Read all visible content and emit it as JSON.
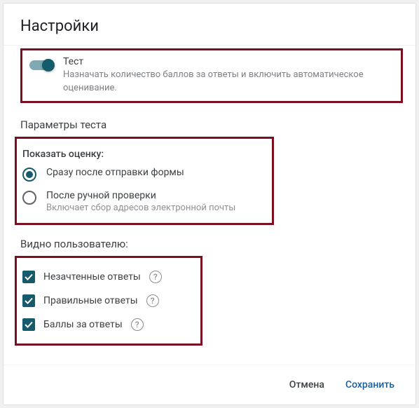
{
  "dialog": {
    "title": "Настройки"
  },
  "quiz_toggle": {
    "label": "Тест",
    "description": "Назначать количество баллов за ответы и включить автоматическое оценивание.",
    "checked": true
  },
  "sections": {
    "params_header": "Параметры теста",
    "release_grade_header": "Показать оценку:",
    "respondent_header": "Видно пользователю:"
  },
  "release": {
    "immediate": {
      "label": "Сразу после отправки формы",
      "selected": true
    },
    "manual": {
      "label": "После ручной проверки",
      "description": "Включает сбор адресов электронной почты",
      "selected": false
    }
  },
  "visible": {
    "missed": {
      "label": "Незачтенные ответы",
      "checked": true
    },
    "correct": {
      "label": "Правильные ответы",
      "checked": true
    },
    "points": {
      "label": "Баллы за ответы",
      "checked": true
    }
  },
  "actions": {
    "cancel": "Отмена",
    "save": "Сохранить"
  },
  "icons": {
    "help_glyph": "?"
  }
}
